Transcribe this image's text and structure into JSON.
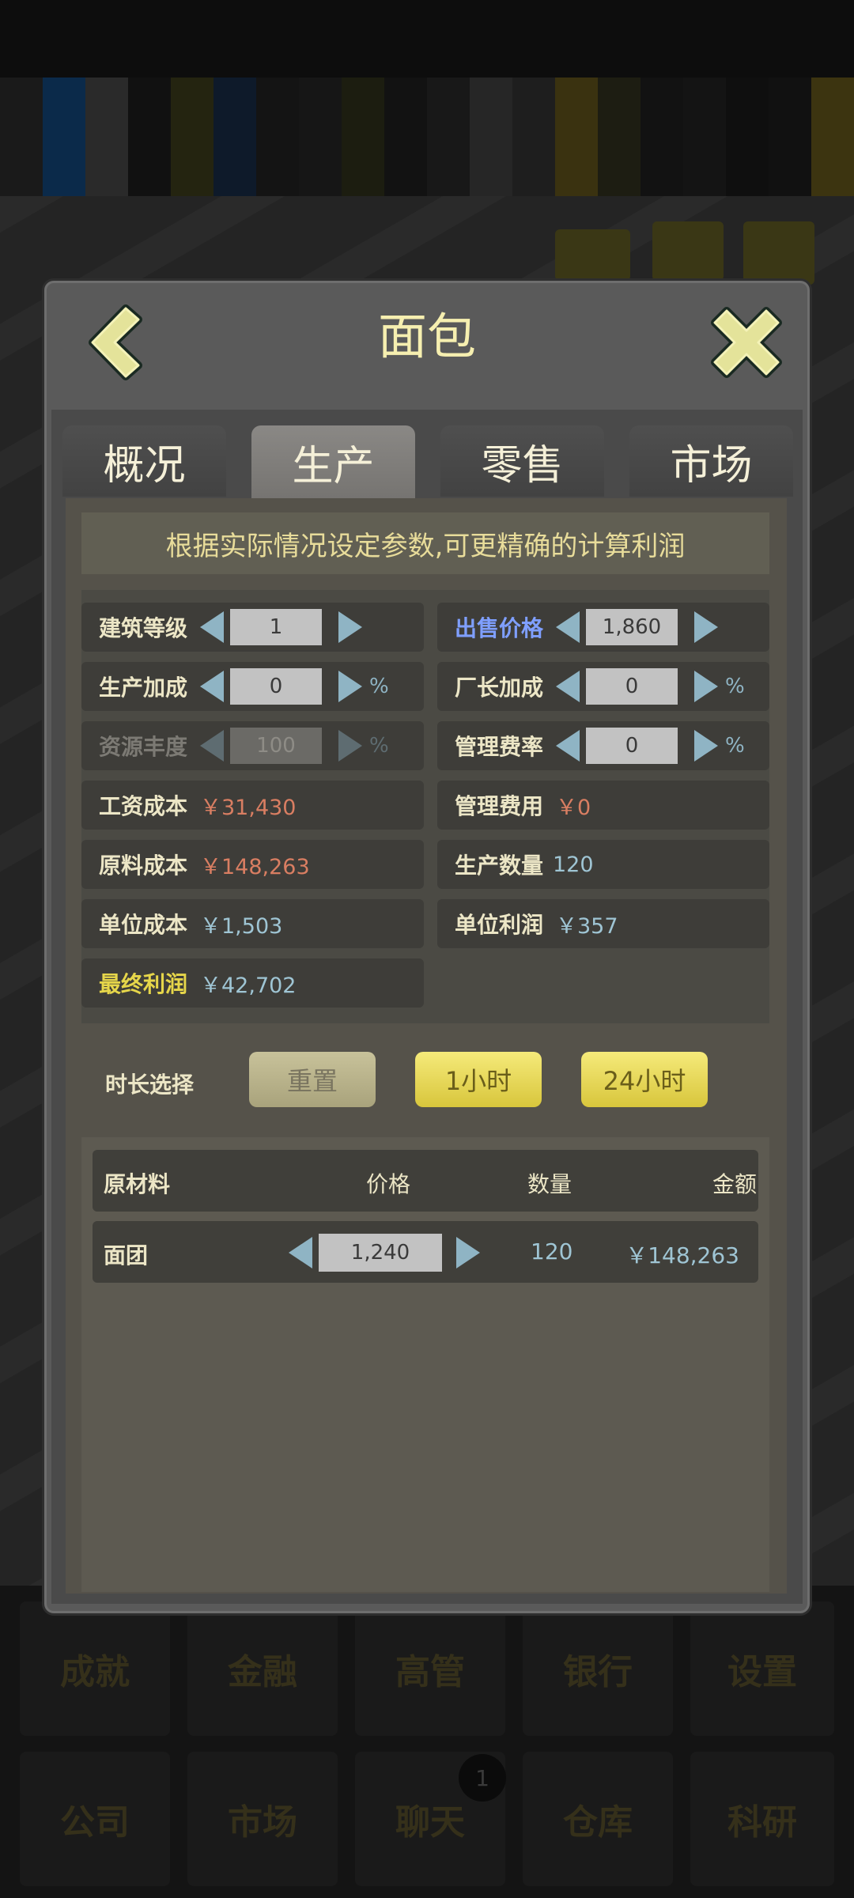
{
  "dialog": {
    "title": "面包",
    "tabs": [
      "概况",
      "生产",
      "零售",
      "市场"
    ],
    "active_tab": "生产",
    "hint": "根据实际情况设定参数,可更精确的计算利润"
  },
  "params": {
    "building_level": {
      "label": "建筑等级",
      "value": "1"
    },
    "sale_price": {
      "label": "出售价格",
      "value": "1,860"
    },
    "production_bonus": {
      "label": "生产加成",
      "value": "0",
      "unit": "%"
    },
    "manager_bonus": {
      "label": "厂长加成",
      "value": "0",
      "unit": "%"
    },
    "resource_richness": {
      "label": "资源丰度",
      "value": "100",
      "unit": "%"
    },
    "management_fee_rate": {
      "label": "管理费率",
      "value": "0",
      "unit": "%"
    },
    "wage_cost": {
      "label": "工资成本",
      "value": "￥31,430"
    },
    "management_fee": {
      "label": "管理费用",
      "value": "￥0"
    },
    "material_cost": {
      "label": "原料成本",
      "value": "￥148,263"
    },
    "production_qty": {
      "label": "生产数量",
      "value": "120"
    },
    "unit_cost": {
      "label": "单位成本",
      "value": "￥1,503"
    },
    "unit_profit": {
      "label": "单位利润",
      "value": "￥357"
    },
    "final_profit": {
      "label": "最终利润",
      "value": "￥42,702"
    }
  },
  "duration": {
    "label": "时长选择",
    "reset": "重置",
    "one_hour": "1小时",
    "day": "24小时"
  },
  "materials": {
    "headers": {
      "name": "原材料",
      "price": "价格",
      "qty": "数量",
      "amount": "金额"
    },
    "rows": [
      {
        "name": "面团",
        "price": "1,240",
        "qty": "120",
        "amount": "￥148,263"
      }
    ]
  },
  "bottom_nav": {
    "row1": [
      "成就",
      "金融",
      "高管",
      "银行",
      "设置"
    ],
    "row2": [
      "公司",
      "市场",
      "聊天",
      "仓库",
      "科研"
    ],
    "chat_badge": "1"
  },
  "colors": {
    "title": "#f6efb0",
    "accent_yellow": "#e6d64a",
    "cost_orange": "#d97e62",
    "value_cyan": "#9fc5d4",
    "price_blue": "#7f9fff"
  }
}
